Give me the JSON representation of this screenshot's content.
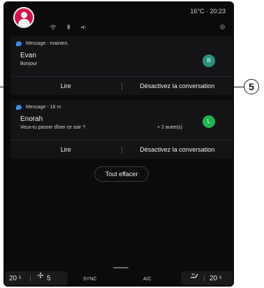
{
  "status_bar": {
    "temperature": "16°C",
    "separator": "·",
    "time": "20:23",
    "icons": [
      "wifi-icon",
      "bluetooth-icon",
      "volume-icon",
      "settings-icon"
    ]
  },
  "notifications": [
    {
      "source": "Message - mainten.",
      "sender": "Evan",
      "message": "Bonjour",
      "extra": "",
      "badge": "B",
      "read_action": "Lire",
      "mute_action": "Désactivez la conversation"
    },
    {
      "source": "Message - 18 m",
      "sender": "Enorah",
      "message": "Veux-tu passer dîner ce soir ?",
      "extra": "+ 2 autre(s)",
      "badge": "L",
      "read_action": "Lire",
      "mute_action": "Désactivez la conversation"
    }
  ],
  "clear_all": "Tout effacer",
  "climate": {
    "left_temp": "20",
    "left_temp_fraction": "5",
    "fan_level": "5",
    "sync": "SYNC",
    "ac": "A/C",
    "right_temp": "20",
    "right_temp_fraction": "5"
  },
  "callout": "5",
  "colors": {
    "screen_bg": "#0b0b0d",
    "card_bg": "#141416",
    "avatar": "#d0144e",
    "badge_evan": "#2e8f7c",
    "badge_enorah": "#20b350",
    "message_icon": "#3b8ee0"
  }
}
